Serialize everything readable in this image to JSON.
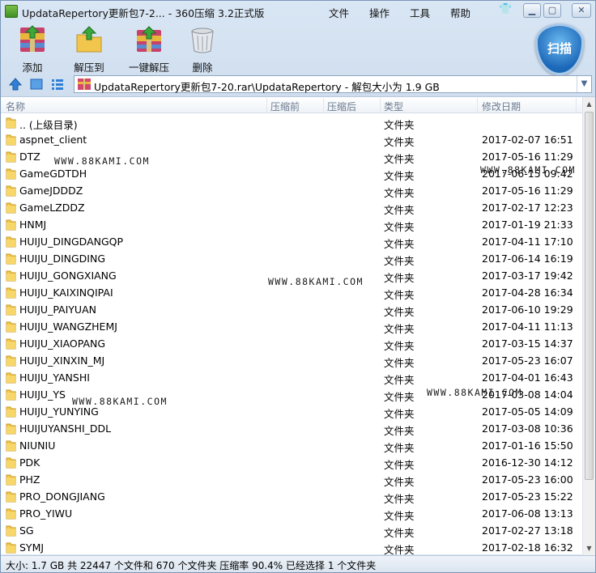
{
  "window": {
    "title": "UpdataRepertory更新包7-2... - 360压缩 3.2正式版",
    "menu": [
      "文件",
      "操作",
      "工具",
      "帮助"
    ]
  },
  "toolbar": {
    "add_label": "添加",
    "extract_to_label": "解压到",
    "one_click_extract_label": "一键解压",
    "delete_label": "删除",
    "scan_label": "扫描"
  },
  "nav": {
    "path": "UpdataRepertory更新包7-20.rar\\UpdataRepertory - 解包大小为 1.9 GB"
  },
  "columns": {
    "name": "名称",
    "compressed_before": "压缩前",
    "compressed_after": "压缩后",
    "type": "类型",
    "modified": "修改日期"
  },
  "files": [
    {
      "name": ".. (上级目录)",
      "type": "文件夹",
      "date": ""
    },
    {
      "name": "aspnet_client",
      "type": "文件夹",
      "date": "2017-02-07 16:51"
    },
    {
      "name": "DTZ",
      "type": "文件夹",
      "date": "2017-05-16 11:29"
    },
    {
      "name": "GameGDTDH",
      "type": "文件夹",
      "date": "2017-06-15 09:42"
    },
    {
      "name": "GameJDDDZ",
      "type": "文件夹",
      "date": "2017-05-16 11:29"
    },
    {
      "name": "GameLZDDZ",
      "type": "文件夹",
      "date": "2017-02-17 12:23"
    },
    {
      "name": "HNMJ",
      "type": "文件夹",
      "date": "2017-01-19 21:33"
    },
    {
      "name": "HUIJU_DINGDANGQP",
      "type": "文件夹",
      "date": "2017-04-11 17:10"
    },
    {
      "name": "HUIJU_DINGDING",
      "type": "文件夹",
      "date": "2017-06-14 16:19"
    },
    {
      "name": "HUIJU_GONGXIANG",
      "type": "文件夹",
      "date": "2017-03-17 19:42"
    },
    {
      "name": "HUIJU_KAIXINQIPAI",
      "type": "文件夹",
      "date": "2017-04-28 16:34"
    },
    {
      "name": "HUIJU_PAIYUAN",
      "type": "文件夹",
      "date": "2017-06-10 19:29"
    },
    {
      "name": "HUIJU_WANGZHEMJ",
      "type": "文件夹",
      "date": "2017-04-11 11:13"
    },
    {
      "name": "HUIJU_XIAOPANG",
      "type": "文件夹",
      "date": "2017-03-15 14:37"
    },
    {
      "name": "HUIJU_XINXIN_MJ",
      "type": "文件夹",
      "date": "2017-05-23 16:07"
    },
    {
      "name": "HUIJU_YANSHI",
      "type": "文件夹",
      "date": "2017-04-01 16:43"
    },
    {
      "name": "HUIJU_YS",
      "type": "文件夹",
      "date": "2017-03-08 14:04"
    },
    {
      "name": "HUIJU_YUNYING",
      "type": "文件夹",
      "date": "2017-05-05 14:09"
    },
    {
      "name": "HUIJUYANSHI_DDL",
      "type": "文件夹",
      "date": "2017-03-08 10:36"
    },
    {
      "name": "NIUNIU",
      "type": "文件夹",
      "date": "2017-01-16 15:50"
    },
    {
      "name": "PDK",
      "type": "文件夹",
      "date": "2016-12-30 14:12"
    },
    {
      "name": "PHZ",
      "type": "文件夹",
      "date": "2017-05-23 16:00"
    },
    {
      "name": "PRO_DONGJIANG",
      "type": "文件夹",
      "date": "2017-05-23 15:22"
    },
    {
      "name": "PRO_YIWU",
      "type": "文件夹",
      "date": "2017-06-08 13:13"
    },
    {
      "name": "SG",
      "type": "文件夹",
      "date": "2017-02-27 13:18"
    },
    {
      "name": "SYMJ",
      "type": "文件夹",
      "date": "2017-02-18 16:32"
    }
  ],
  "watermarks": [
    "WWW.88KAMI.COM",
    "WWW.88KAMI.COM",
    "WWW.88KAMI.COM",
    "WWW.88KAMI.COM",
    "WWW.88KAMI.COM"
  ],
  "status": {
    "text": "大小: 1.7 GB 共 22447 个文件和 670 个文件夹 压缩率 90.4% 已经选择 1 个文件夹"
  }
}
